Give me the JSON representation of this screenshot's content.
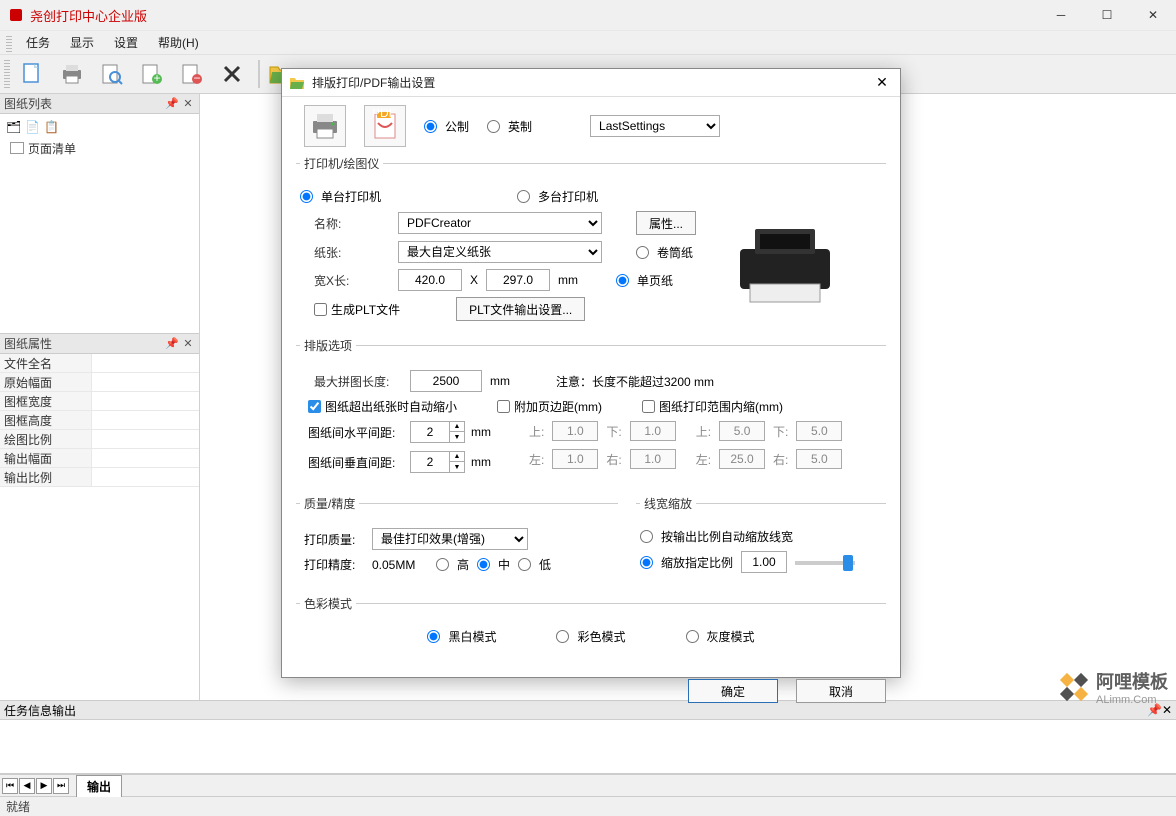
{
  "app": {
    "title": "尧创打印中心企业版"
  },
  "menu": {
    "task": "任务",
    "display": "显示",
    "settings": "设置",
    "help": "帮助(H)"
  },
  "panels": {
    "drawing_list": {
      "title": "图纸列表",
      "tree_item": "页面清单"
    },
    "props": {
      "title": "图纸属性",
      "rows": [
        "文件全名",
        "原始幅面",
        "图框宽度",
        "图框高度",
        "绘图比例",
        "输出幅面",
        "输出比例"
      ]
    },
    "task_output": {
      "title": "任务信息输出"
    }
  },
  "tabs": {
    "output": "输出"
  },
  "status": {
    "ready": "就绪"
  },
  "dialog": {
    "title": "排版打印/PDF输出设置",
    "units": {
      "metric": "公制",
      "imperial": "英制",
      "preset": "LastSettings"
    },
    "printer_section": {
      "legend": "打印机/绘图仪",
      "single": "单台打印机",
      "multi": "多台打印机",
      "name_label": "名称:",
      "name_value": "PDFCreator",
      "props_btn": "属性...",
      "paper_label": "纸张:",
      "paper_value": "最大自定义纸张",
      "roll": "卷筒纸",
      "sheet": "单页纸",
      "wh_label": "宽X长:",
      "width": "420.0",
      "height": "297.0",
      "x": "X",
      "mm": "mm",
      "gen_plt": "生成PLT文件",
      "plt_btn": "PLT文件输出设置..."
    },
    "layout_section": {
      "legend": "排版选项",
      "max_len_label": "最大拼图长度:",
      "max_len": "2500",
      "mm": "mm",
      "note": "注意：长度不能超过3200 mm",
      "auto_shrink": "图纸超出纸张时自动缩小",
      "page_margin": "附加页边距(mm)",
      "inner_margin": "图纸打印范围内缩(mm)",
      "hspace_label": "图纸间水平间距:",
      "hspace": "2",
      "vspace_label": "图纸间垂直间距:",
      "vspace": "2",
      "top": "上:",
      "bottom": "下:",
      "left": "左:",
      "right": "右:",
      "pm_top": "1.0",
      "pm_bottom": "1.0",
      "pm_left": "1.0",
      "pm_right": "1.0",
      "im_top": "5.0",
      "im_bottom": "5.0",
      "im_left": "25.0",
      "im_right": "5.0"
    },
    "quality_section": {
      "legend": "质量/精度",
      "quality_label": "打印质量:",
      "quality_value": "最佳打印效果(增强)",
      "precision_label": "打印精度:",
      "precision_value": "0.05MM",
      "high": "高",
      "mid": "中",
      "low": "低"
    },
    "linewidth_section": {
      "legend": "线宽缩放",
      "auto_scale": "按输出比例自动缩放线宽",
      "fixed_scale": "缩放指定比例",
      "scale_value": "1.00"
    },
    "color_section": {
      "legend": "色彩模式",
      "bw": "黑白模式",
      "color": "彩色模式",
      "gray": "灰度模式"
    },
    "ok": "确定",
    "cancel": "取消"
  },
  "watermark": {
    "name": "阿哩模板",
    "url": "ALimm.Com"
  }
}
